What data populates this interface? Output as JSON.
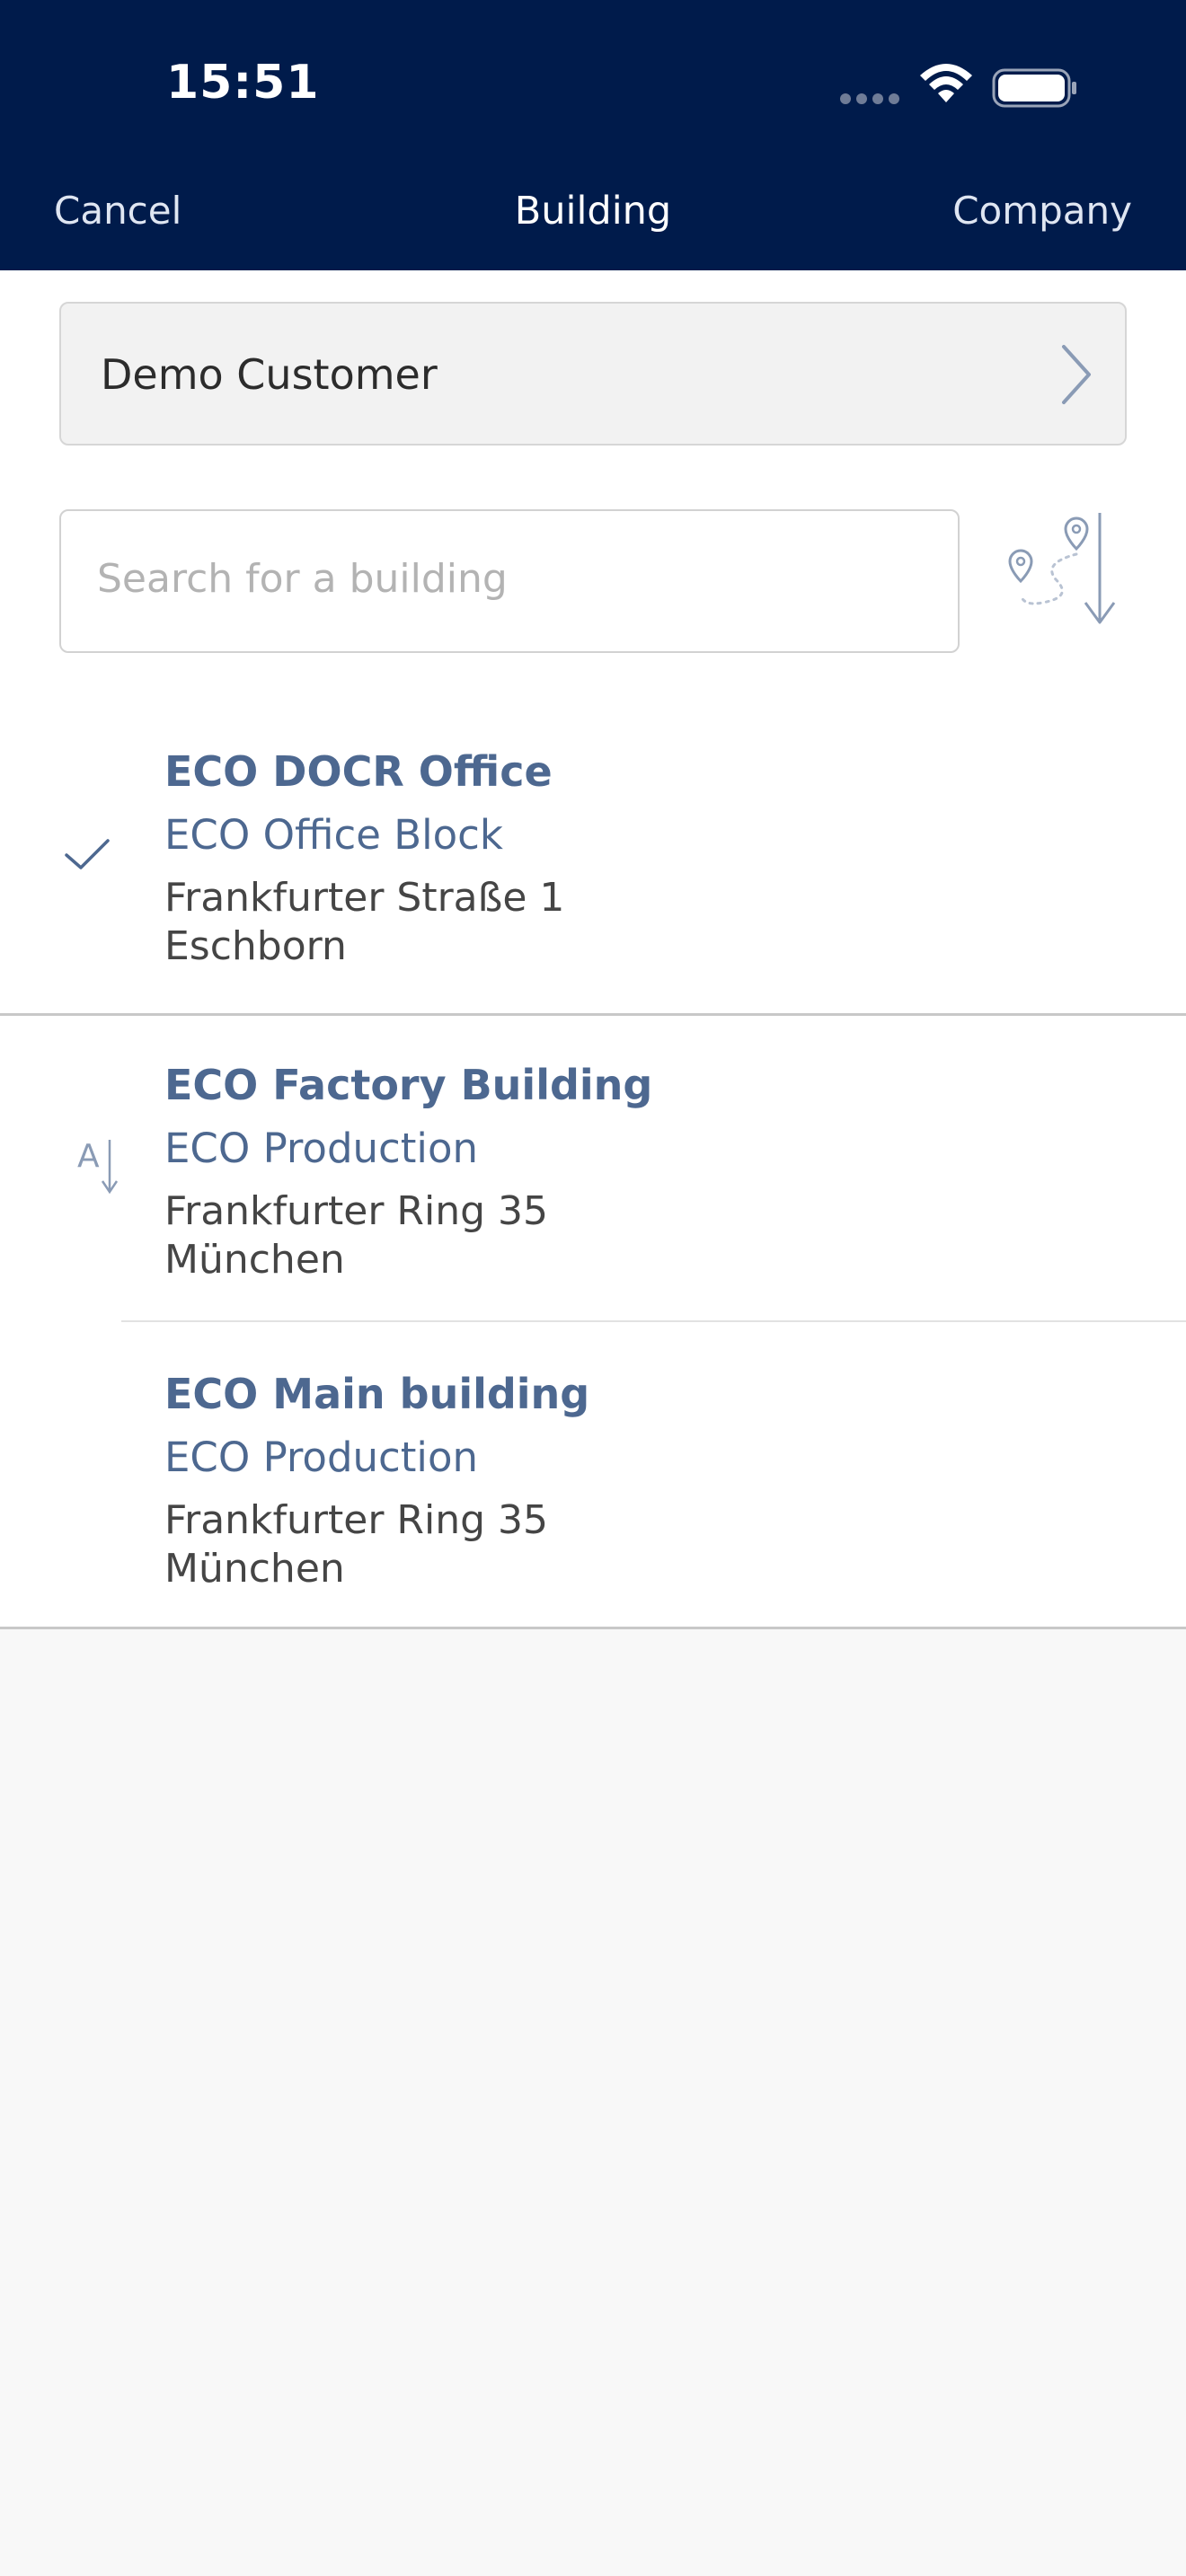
{
  "status_bar": {
    "time": "15:51"
  },
  "nav": {
    "cancel": "Cancel",
    "title": "Building",
    "company": "Company"
  },
  "customer": {
    "label": "Demo Customer"
  },
  "search": {
    "placeholder": "Search for a building"
  },
  "colors": {
    "header_bg": "#001b4b",
    "accent": "#4d6890"
  },
  "buildings": [
    {
      "title": "ECO DOCR Office",
      "subtitle": "ECO Office Block",
      "street": "Frankfurter Straße 1",
      "city": "Eschborn",
      "selected": true
    },
    {
      "title": "ECO Factory Building",
      "subtitle": "ECO Production",
      "street": "Frankfurter Ring 35",
      "city": "München"
    },
    {
      "title": "ECO Main building",
      "subtitle": "ECO Production",
      "street": "Frankfurter Ring 35",
      "city": "München"
    }
  ],
  "section_index_label": "A"
}
